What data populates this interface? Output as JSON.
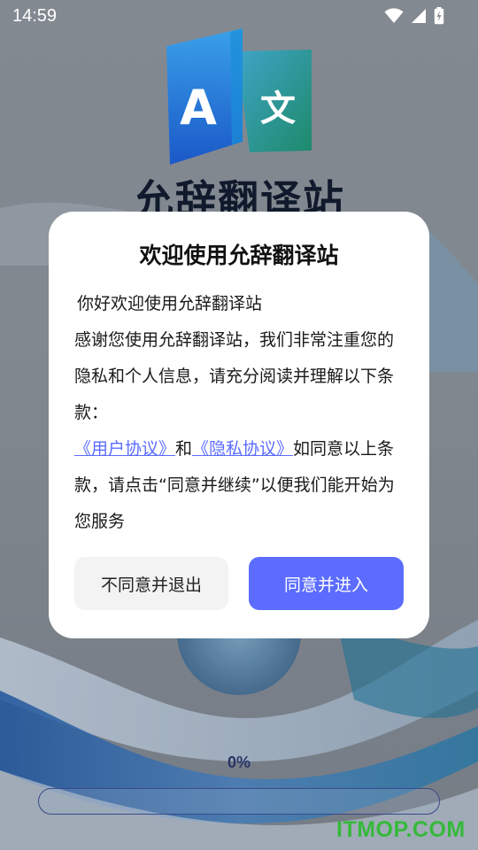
{
  "status_bar": {
    "time": "14:59",
    "icons": [
      "wifi-icon",
      "cellular-signal-icon",
      "battery-charging-icon"
    ]
  },
  "splash": {
    "logo_icon": "translate-a-wen-icon",
    "logo_letter_a": "A",
    "logo_letter_wen": "文",
    "brand_name": "允辞翻译站"
  },
  "dialog": {
    "title": "欢迎使用允辞翻译站",
    "greeting": "你好欢迎使用允辞翻译站",
    "body_intro": "感谢您使用允辞翻译站，我们非常注重您的隐私和个人信息，请充分阅读并理解以下条款：",
    "user_agreement_link": "《用户协议》",
    "connector": "和",
    "privacy_agreement_link": "《隐私协议》",
    "body_tail": "如同意以上条款，请点击“同意并继续”以便我们能开始为您服务",
    "disagree_button": "不同意并退出",
    "agree_button": "同意并进入"
  },
  "progress": {
    "label": "0%",
    "value": 0
  },
  "watermark": "ITMOP.COM",
  "colors": {
    "accent": "#5b6cff",
    "dialog_background": "#ffffff",
    "disagree_button_background": "#f3f3f3",
    "watermark": "#36b93b"
  }
}
